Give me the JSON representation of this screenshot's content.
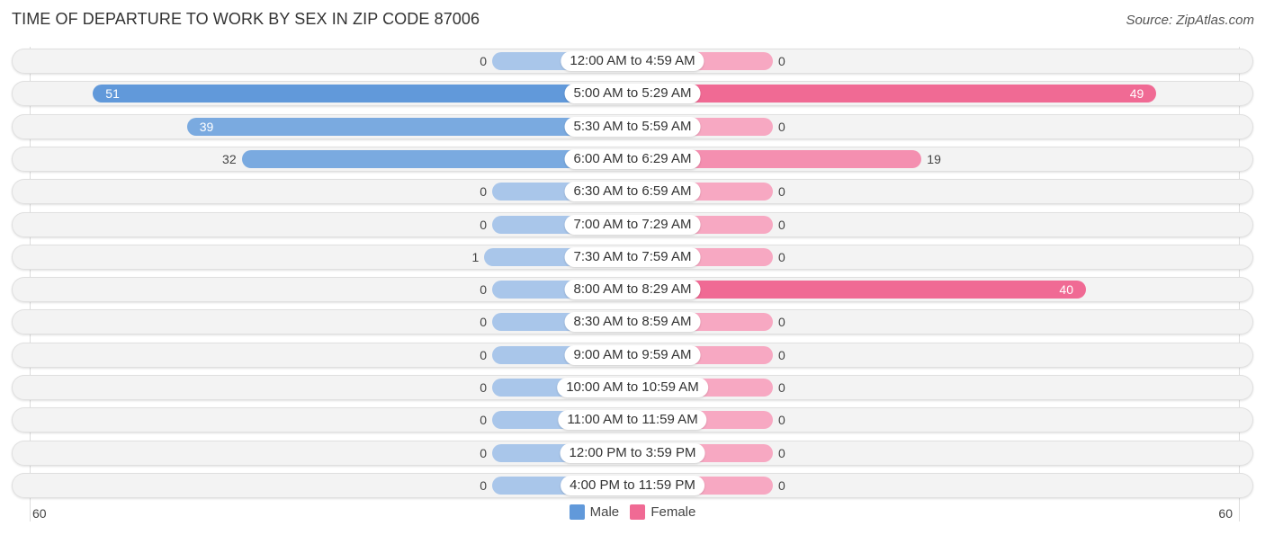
{
  "title": "TIME OF DEPARTURE TO WORK BY SEX IN ZIP CODE 87006",
  "source": "Source: ZipAtlas.com",
  "colors": {
    "male": "#6199da",
    "male_light": "#a9c6ea",
    "female": "#f06a94",
    "female_light": "#f7a8c2"
  },
  "chart_data": {
    "type": "bar",
    "orientation": "horizontal-diverging",
    "title": "TIME OF DEPARTURE TO WORK BY SEX IN ZIP CODE 87006",
    "categories": [
      "12:00 AM to 4:59 AM",
      "5:00 AM to 5:29 AM",
      "5:30 AM to 5:59 AM",
      "6:00 AM to 6:29 AM",
      "6:30 AM to 6:59 AM",
      "7:00 AM to 7:29 AM",
      "7:30 AM to 7:59 AM",
      "8:00 AM to 8:29 AM",
      "8:30 AM to 8:59 AM",
      "9:00 AM to 9:59 AM",
      "10:00 AM to 10:59 AM",
      "11:00 AM to 11:59 AM",
      "12:00 PM to 3:59 PM",
      "4:00 PM to 11:59 PM"
    ],
    "series": [
      {
        "name": "Male",
        "values": [
          0,
          51,
          39,
          32,
          0,
          0,
          1,
          0,
          0,
          0,
          0,
          0,
          0,
          0
        ]
      },
      {
        "name": "Female",
        "values": [
          0,
          49,
          0,
          19,
          0,
          0,
          0,
          40,
          0,
          0,
          0,
          0,
          0,
          0
        ]
      }
    ],
    "axis": {
      "left_max_label": "60",
      "right_max_label": "60",
      "range": [
        0,
        60
      ]
    },
    "legend": {
      "position": "bottom-center",
      "entries": [
        "Male",
        "Female"
      ]
    },
    "grid": false
  }
}
